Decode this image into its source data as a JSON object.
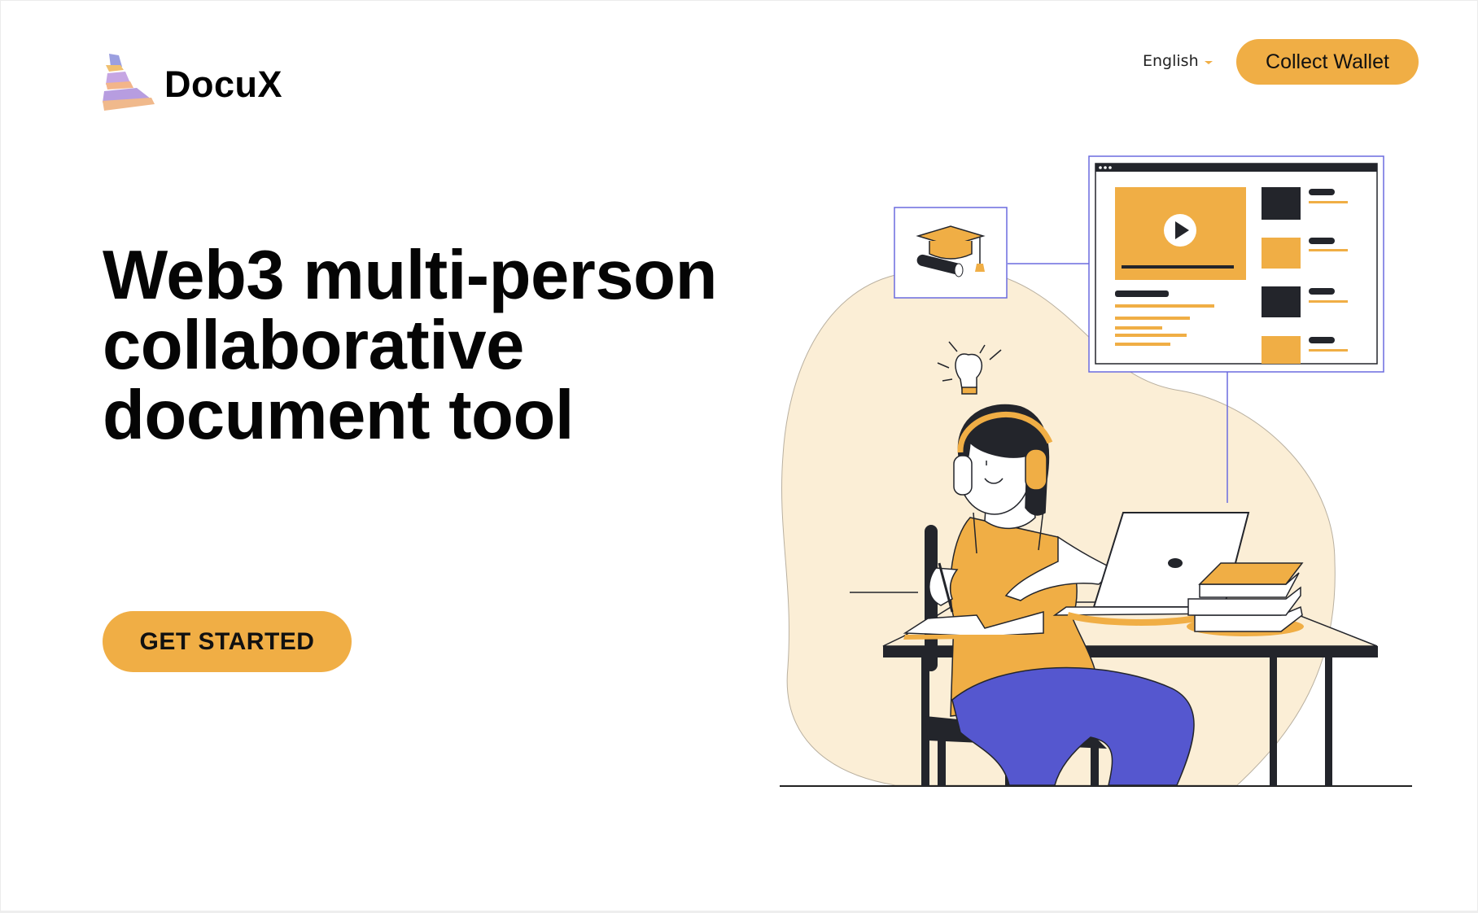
{
  "header": {
    "logo_text": "DocuX",
    "language_label": "English",
    "wallet_button_label": "Collect Wallet"
  },
  "hero": {
    "title_lines": [
      "Web3 multi-person",
      "collaborative",
      "document tool"
    ],
    "cta_label": "GET STARTED"
  },
  "colors": {
    "accent": "#f0ae45",
    "blob": "#fbeed6",
    "dark": "#23252b",
    "pants": "#5557cf",
    "frame_outline": "#6b6bdf"
  },
  "icons": {
    "language_caret": "chevron-down-icon",
    "play": "play-icon",
    "graduation": "graduation-cap-icon",
    "idea": "lightbulb-icon"
  }
}
